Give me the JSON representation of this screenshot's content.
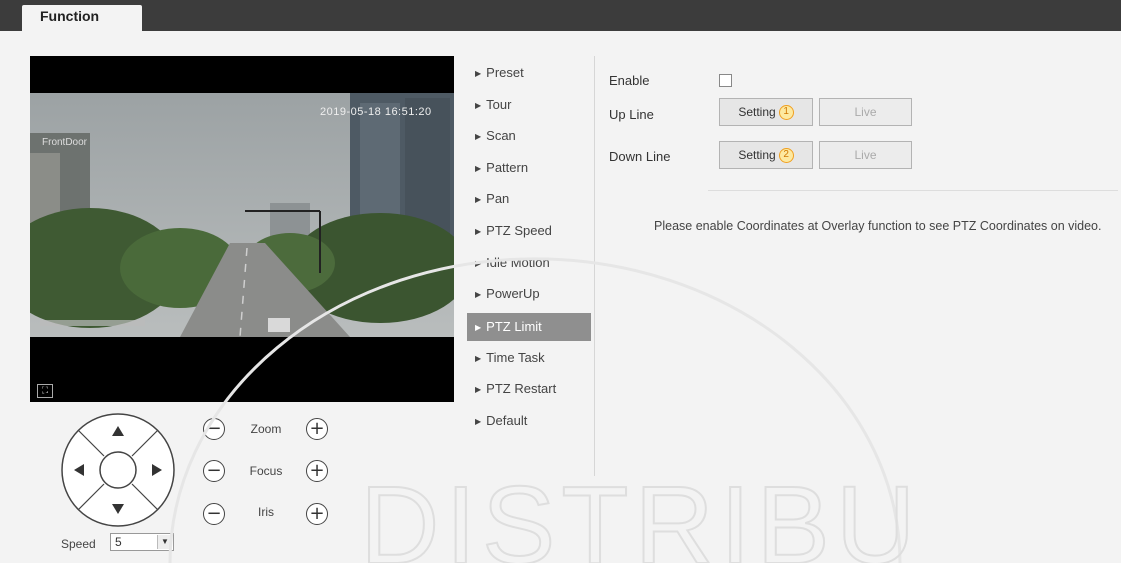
{
  "tab": {
    "label": "Function"
  },
  "video": {
    "timestamp": "2019-05-18 16:51:20",
    "channel_name": "FrontDoor"
  },
  "ptz": {
    "zoom_label": "Zoom",
    "focus_label": "Focus",
    "iris_label": "Iris",
    "speed_label": "Speed",
    "speed_value": "5",
    "minus_glyph": "−",
    "plus_glyph": "+"
  },
  "menu": {
    "items": [
      {
        "label": "Preset"
      },
      {
        "label": "Tour"
      },
      {
        "label": "Scan"
      },
      {
        "label": "Pattern"
      },
      {
        "label": "Pan"
      },
      {
        "label": "PTZ Speed"
      },
      {
        "label": "Idle Motion"
      },
      {
        "label": "PowerUp"
      },
      {
        "label": "PTZ Limit"
      },
      {
        "label": "Time Task"
      },
      {
        "label": "PTZ Restart"
      },
      {
        "label": "Default"
      }
    ],
    "active": "PTZ Limit"
  },
  "form": {
    "enable_label": "Enable",
    "enable_checked": false,
    "up_line_label": "Up Line",
    "down_line_label": "Down Line",
    "setting_label": "Setting",
    "live_label": "Live",
    "marker_1": "1",
    "marker_2": "2",
    "note": "Please enable Coordinates at Overlay function to see PTZ Coordinates on video."
  },
  "watermark": "DISTRIBU",
  "colors": {
    "header": "#3c3c3c",
    "active_menu": "#8f8f8f",
    "marker": "#f0a020"
  }
}
